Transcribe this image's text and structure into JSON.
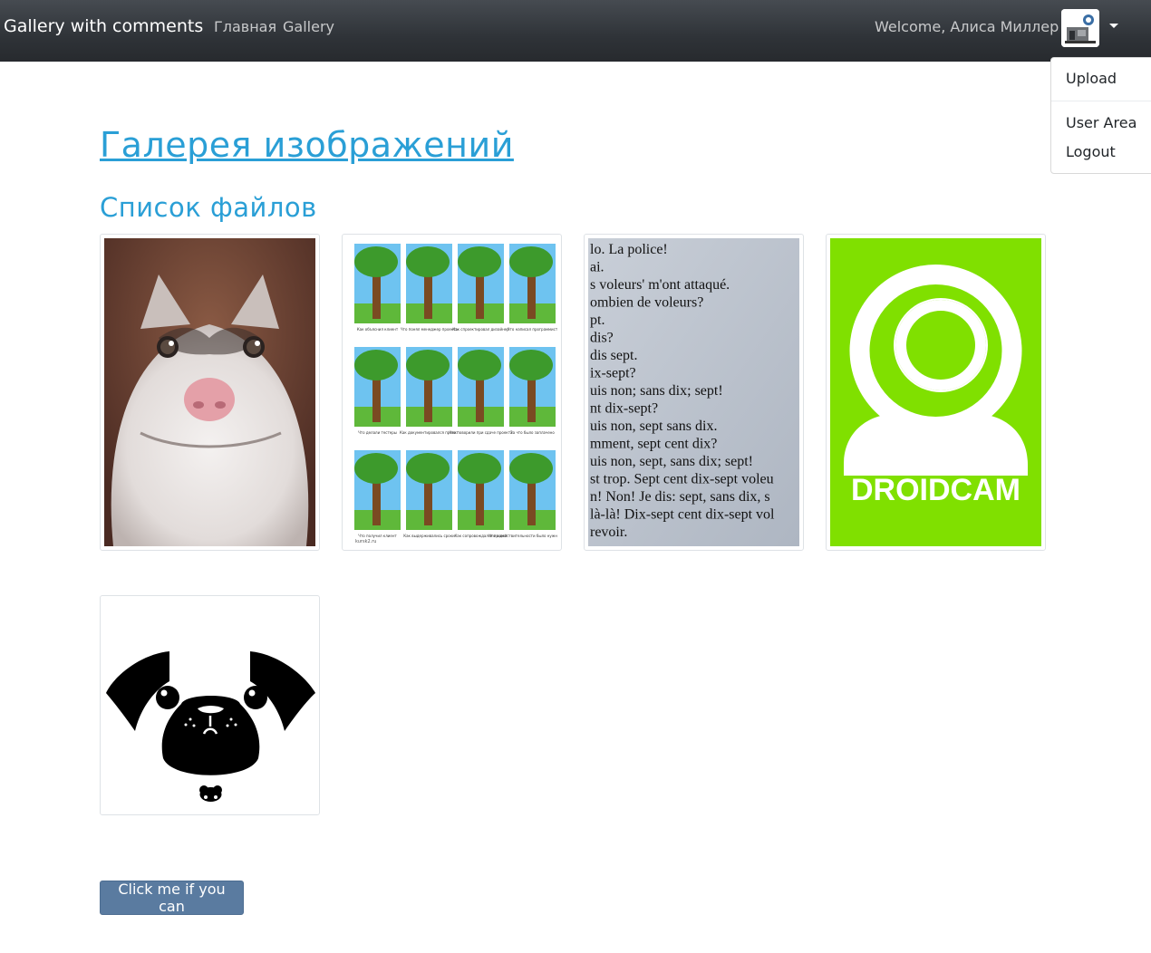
{
  "navbar": {
    "brand": "Gallery with comments",
    "links": [
      "Главная",
      "Gallery"
    ],
    "welcome": "Welcome, Алиса Миллер",
    "avatar_icon": "avatar-icon",
    "caret_icon": "caret-down-icon"
  },
  "dropdown": {
    "items": [
      "Upload",
      "User Area",
      "Logout"
    ]
  },
  "page": {
    "title": "Галерея изображений",
    "subtitle": "Список файлов"
  },
  "comic": {
    "captions": [
      "Как объяснил клиент",
      "Что понял менеджер проекта",
      "Как спроектировал дизайнер",
      "Что написал программист",
      "Что делали тестеры",
      "Как документировался проект",
      "Что поворили при сдаче проекта",
      "За что было заплачено",
      "Что получил клиент",
      "Как выдерживались сроки",
      "Как сопровождался проект",
      "Что в действительности было нужно клиенту"
    ],
    "watermark": "kursk2.ru"
  },
  "text_photo": {
    "lines": [
      "lo. La police!",
      "ai.",
      "s voleurs' m'ont attaqué.",
      "ombien de voleurs?",
      "pt.",
      " dis?",
      " dis sept.",
      "ix-sept?",
      "uis non; sans dix; sept!",
      "nt dix-sept?",
      "uis non, sept sans dix.",
      "mment, sept cent dix?",
      "uis non, sept, sans dix; sept!",
      "st trop. Sept cent dix-sept voleu",
      "n! Non! Je dis: sept, sans dix, s",
      "là-là! Dix-sept cent dix-sept vol",
      " revoir."
    ]
  },
  "droidcam": {
    "label": "DROIDCAM",
    "color": "#80e000"
  },
  "button": {
    "label": "Click me if you can"
  },
  "colors": {
    "accent": "#2a9fd6",
    "button": "#5a7ba0"
  }
}
